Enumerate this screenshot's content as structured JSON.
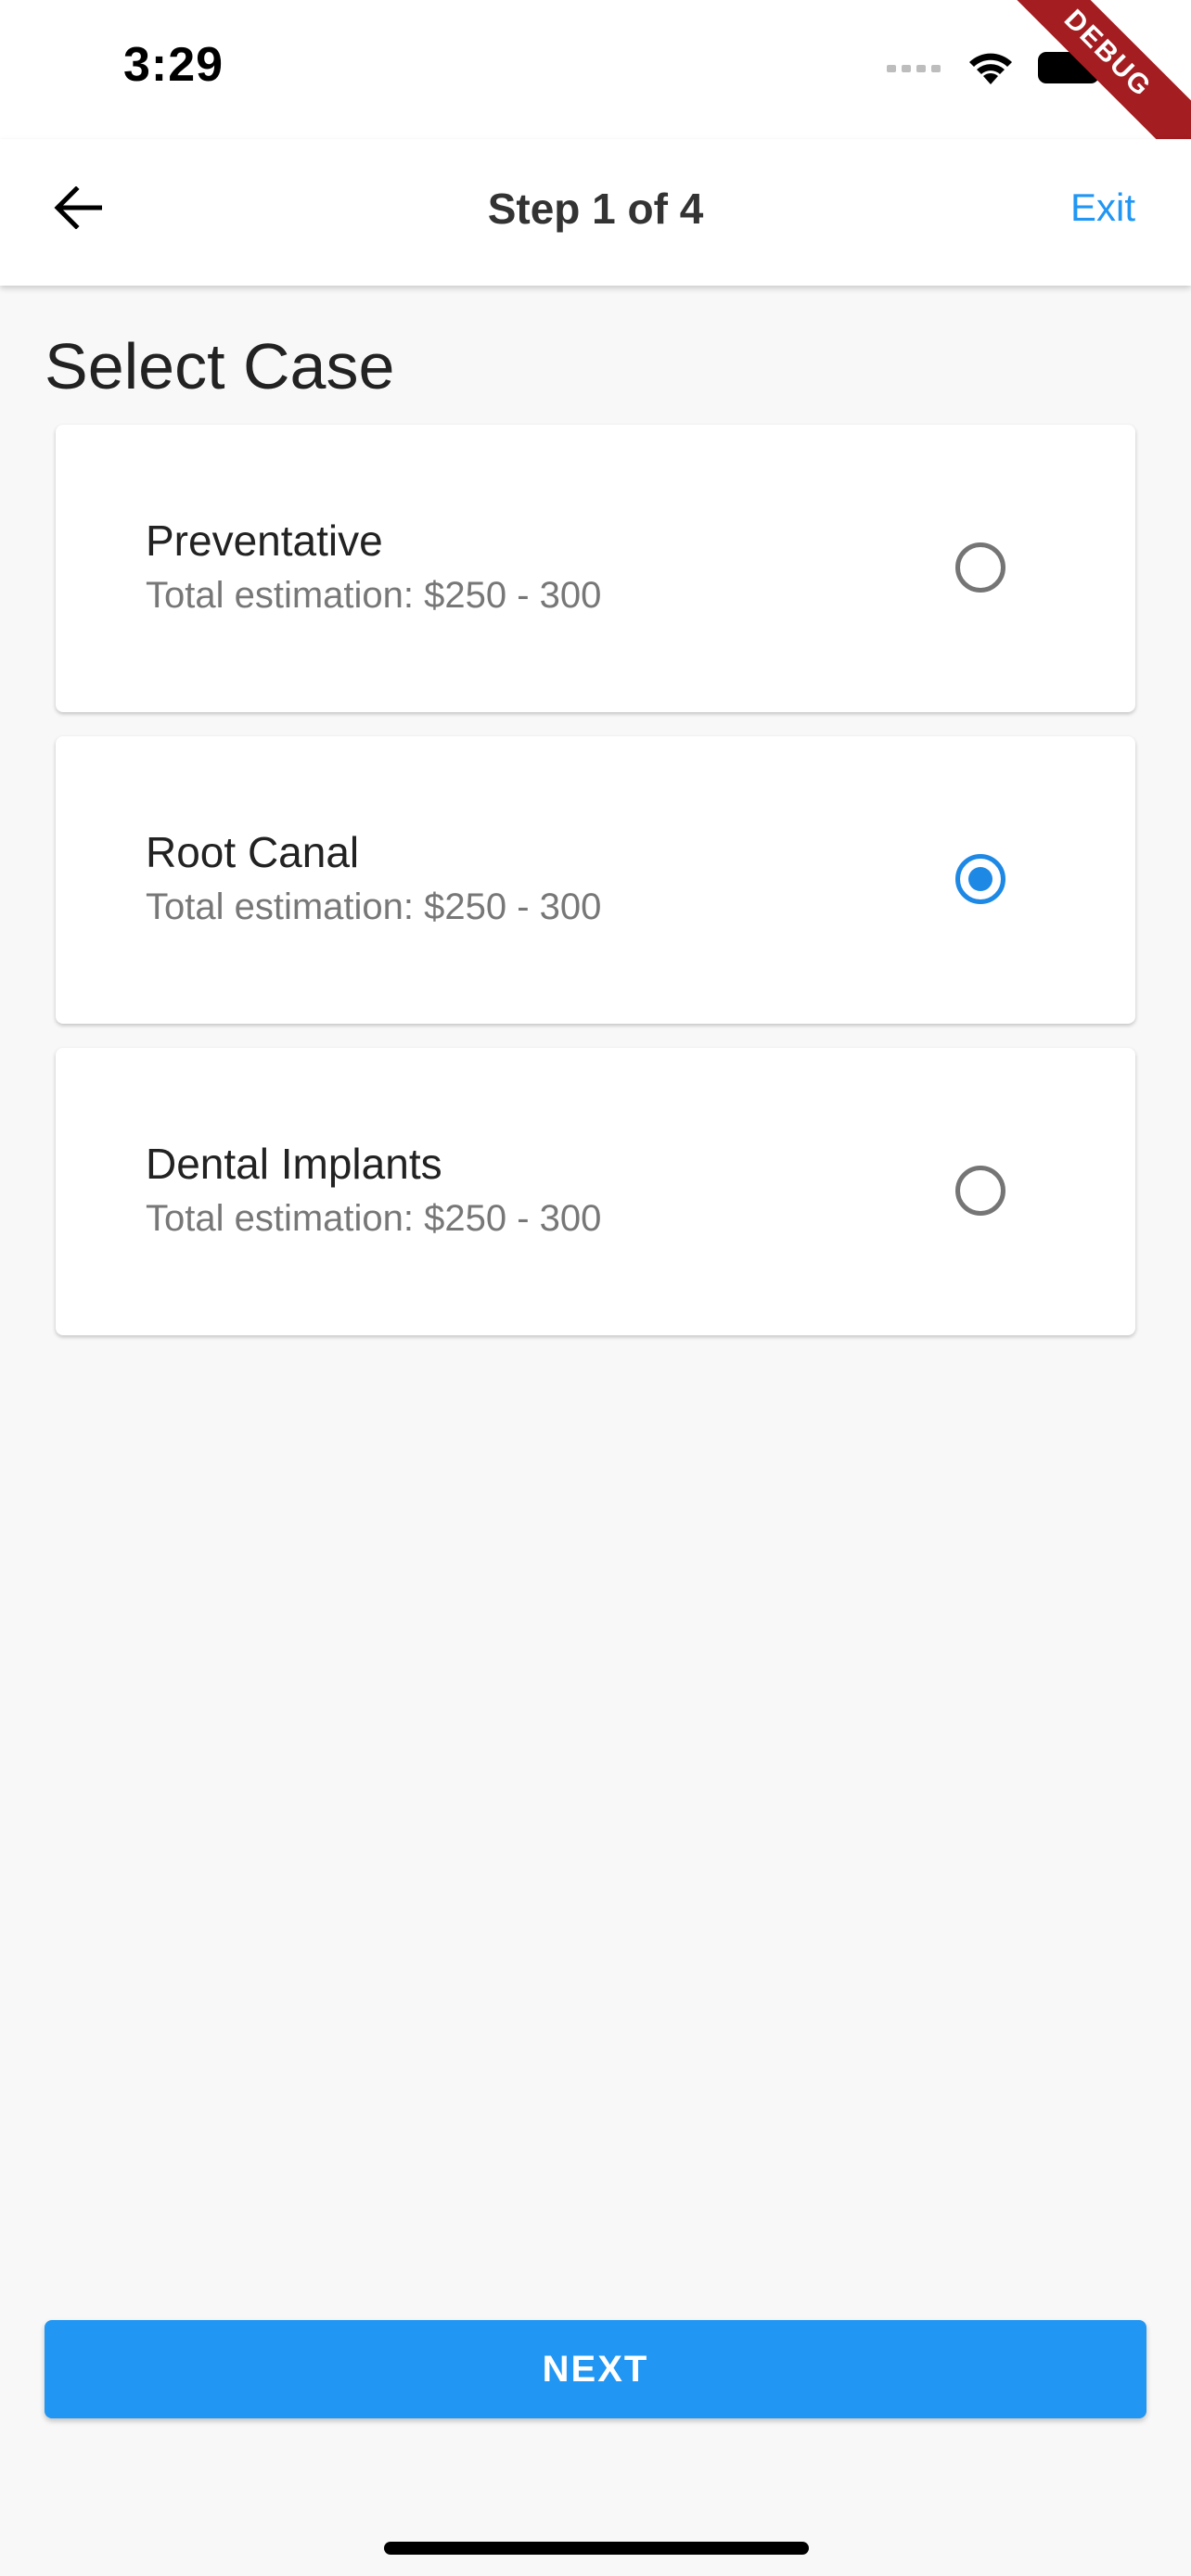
{
  "status_bar": {
    "time": "3:29",
    "icons": [
      "cellular-icon",
      "wifi-icon",
      "battery-icon"
    ],
    "debug_banner": "DEBUG"
  },
  "app_bar": {
    "title": "Step 1 of 4",
    "exit_label": "Exit",
    "back_icon": "arrow-left-icon"
  },
  "page": {
    "heading": "Select Case"
  },
  "cases": [
    {
      "name": "Preventative",
      "estimate": "Total estimation: $250 - 300",
      "selected": false
    },
    {
      "name": "Root Canal",
      "estimate": "Total estimation: $250 - 300",
      "selected": true
    },
    {
      "name": "Dental Implants",
      "estimate": "Total estimation: $250 - 300",
      "selected": false
    }
  ],
  "footer": {
    "next_label": "NEXT"
  },
  "colors": {
    "accent": "#2196f3",
    "radio_selected": "#1e88e5",
    "radio_unselected": "#757575",
    "debug_banner": "#a31d21"
  }
}
